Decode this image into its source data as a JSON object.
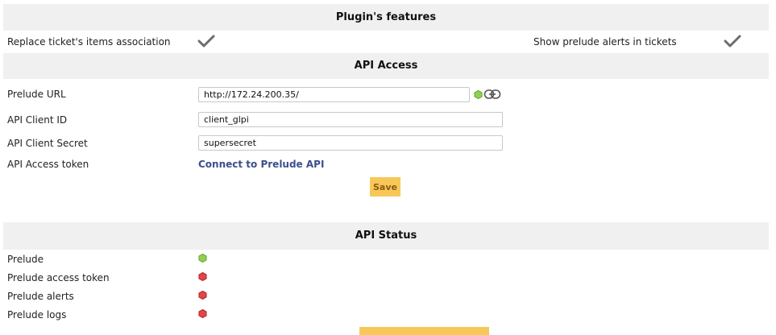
{
  "features": {
    "title": "Plugin's features",
    "replace_label": "Replace ticket's items association",
    "show_alerts_label": "Show prelude alerts in tickets",
    "check_icon": "check-icon"
  },
  "api_access": {
    "title": "API Access",
    "prelude_url_label": "Prelude URL",
    "prelude_url_value": "http://172.24.200.35/",
    "client_id_label": "API Client ID",
    "client_id_value": "client_glpi",
    "client_secret_label": "API Client Secret",
    "client_secret_value": "supersecret",
    "access_token_label": "API Access token",
    "connect_link": "Connect to Prelude API",
    "save_label": "Save",
    "url_status_icon": "green-hexagon-icon",
    "link_icon": "chain-link-icon"
  },
  "api_status": {
    "title": "API Status",
    "items": [
      {
        "label": "Prelude",
        "status": "ok",
        "color": "#8fd14f"
      },
      {
        "label": "Prelude access token",
        "status": "error",
        "color": "#e24646"
      },
      {
        "label": "Prelude alerts",
        "status": "error",
        "color": "#e24646"
      },
      {
        "label": "Prelude logs",
        "status": "error",
        "color": "#e24646"
      }
    ]
  },
  "colors": {
    "header_bg": "#f0f0f0",
    "button_bg": "#f7c858",
    "link": "#3b4f8c",
    "ok": "#8fd14f",
    "error": "#e24646"
  }
}
